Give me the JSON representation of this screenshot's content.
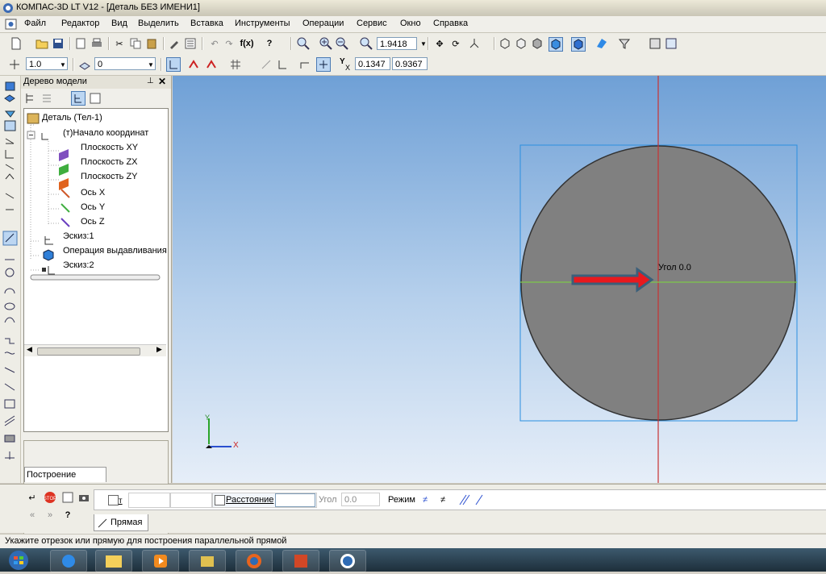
{
  "window": {
    "title": "КОМПАС-3D LT V12 - [Деталь БЕЗ ИМЕНИ1]"
  },
  "menu": [
    "Файл",
    "Редактор",
    "Вид",
    "Выделить",
    "Вставка",
    "Инструменты",
    "Операции",
    "Сервис",
    "Окно",
    "Справка"
  ],
  "toolbar1": {
    "zoom_value": "1.9418"
  },
  "toolbar2": {
    "step_value": "1.0",
    "layer_value": "0",
    "coord_x": "0.1347",
    "coord_y": "0.9367",
    "coord_label": "Y",
    "coord_sublabel": "X"
  },
  "tree": {
    "header": "Дерево модели",
    "nodes": [
      {
        "label": "Деталь (Тел-1)"
      },
      {
        "label": "(т)Начало координат"
      },
      {
        "label": "Плоскость XY"
      },
      {
        "label": "Плоскость ZX"
      },
      {
        "label": "Плоскость ZY"
      },
      {
        "label": "Ось X"
      },
      {
        "label": "Ось Y"
      },
      {
        "label": "Ось Z"
      },
      {
        "label": "Эскиз:1"
      },
      {
        "label": "Операция выдавливания"
      },
      {
        "label": "Эскиз:2"
      }
    ],
    "tab": "Построение"
  },
  "viewport": {
    "angle_label": "Угол 0.0",
    "axis_x": "X",
    "axis_y": "Y"
  },
  "props": {
    "t_label": "т",
    "distance_label": "Расстояние",
    "angle_label": "Угол",
    "angle_value": "0.0",
    "mode_label": "Режим",
    "tab": "Прямая"
  },
  "status": "Укажите отрезок или прямую для построения параллельной прямой",
  "colors": {
    "viewport_top": "#6fa0d6",
    "circle": "#808080",
    "arrow": "#e8191e",
    "axis_line": "#c83232",
    "green_line": "#7ec84a"
  }
}
